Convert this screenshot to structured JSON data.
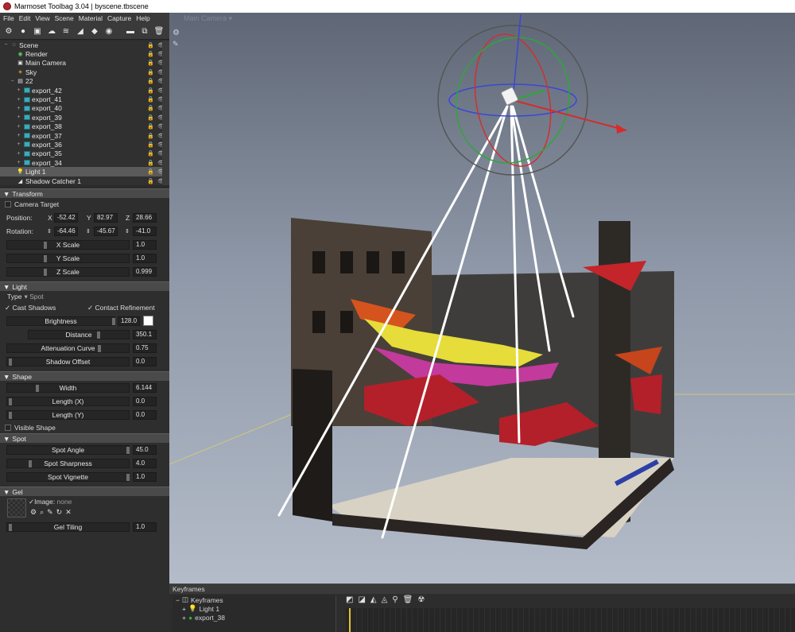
{
  "window": {
    "title": "Marmoset Toolbag 3.04  |  byscene.tbscene"
  },
  "menu": [
    "File",
    "Edit",
    "View",
    "Scene",
    "Material",
    "Capture",
    "Help"
  ],
  "outliner": {
    "items": [
      {
        "label": "Scene",
        "depth": 0,
        "icon": "scene-icon"
      },
      {
        "label": "Render",
        "depth": 1,
        "icon": "render-icon"
      },
      {
        "label": "Main Camera",
        "depth": 1,
        "icon": "camera-icon"
      },
      {
        "label": "Sky",
        "depth": 1,
        "icon": "sky-icon"
      },
      {
        "label": "22",
        "depth": 1,
        "icon": "group-icon"
      },
      {
        "label": "export_42",
        "depth": 2,
        "icon": "mesh-icon"
      },
      {
        "label": "export_41",
        "depth": 2,
        "icon": "mesh-icon"
      },
      {
        "label": "export_40",
        "depth": 2,
        "icon": "mesh-icon"
      },
      {
        "label": "export_39",
        "depth": 2,
        "icon": "mesh-icon"
      },
      {
        "label": "export_38",
        "depth": 2,
        "icon": "mesh-icon"
      },
      {
        "label": "export_37",
        "depth": 2,
        "icon": "mesh-icon"
      },
      {
        "label": "export_36",
        "depth": 2,
        "icon": "mesh-icon"
      },
      {
        "label": "export_35",
        "depth": 2,
        "icon": "mesh-icon"
      },
      {
        "label": "export_34",
        "depth": 2,
        "icon": "mesh-icon"
      },
      {
        "label": "Light 1",
        "depth": 1,
        "icon": "light-icon",
        "selected": true
      },
      {
        "label": "Shadow Catcher 1",
        "depth": 1,
        "icon": "shadow-catcher-icon"
      }
    ]
  },
  "transform": {
    "section": "Transform",
    "camera_target": "Camera Target",
    "position_label": "Position:",
    "rotation_label": "Rotation:",
    "x": "X",
    "y": "Y",
    "z": "Z",
    "pos_x": "-52.42",
    "pos_y": "82.97",
    "pos_z": "28.66",
    "rot_x": "-64.46",
    "rot_y": "-45.67",
    "rot_z": "-41.0",
    "x_scale": "X Scale",
    "x_scale_val": "1.0",
    "y_scale": "Y Scale",
    "y_scale_val": "1.0",
    "z_scale": "Z Scale",
    "z_scale_val": "0.999"
  },
  "light": {
    "section": "Light",
    "type_label": "Type",
    "type_value": "Spot",
    "cast_shadows": "Cast Shadows",
    "contact_refinement": "Contact Refinement",
    "brightness": "Brightness",
    "brightness_val": "128.0",
    "distance": "Distance",
    "distance_val": "350.1",
    "attenuation": "Attenuation Curve",
    "attenuation_val": "0.75",
    "shadow_offset": "Shadow Offset",
    "shadow_offset_val": "0.0",
    "color": "#ffffff"
  },
  "shape": {
    "section": "Shape",
    "width": "Width",
    "width_val": "6.144",
    "length_x": "Length (X)",
    "length_x_val": "0.0",
    "length_y": "Length (Y)",
    "length_y_val": "0.0",
    "visible_shape": "Visible Shape"
  },
  "spot": {
    "section": "Spot",
    "angle": "Spot Angle",
    "angle_val": "45.0",
    "sharpness": "Spot Sharpness",
    "sharpness_val": "4.0",
    "vignette": "Spot Vignette",
    "vignette_val": "1.0"
  },
  "gel": {
    "section": "Gel",
    "image_label": "Image:",
    "image_value": "none",
    "tiling": "Gel Tiling",
    "tiling_val": "1.0"
  },
  "viewport": {
    "camera_label": "Main Camera"
  },
  "keyframes": {
    "title": "Keyframes",
    "items": [
      "Keyframes",
      "Light 1",
      "export_38"
    ]
  }
}
